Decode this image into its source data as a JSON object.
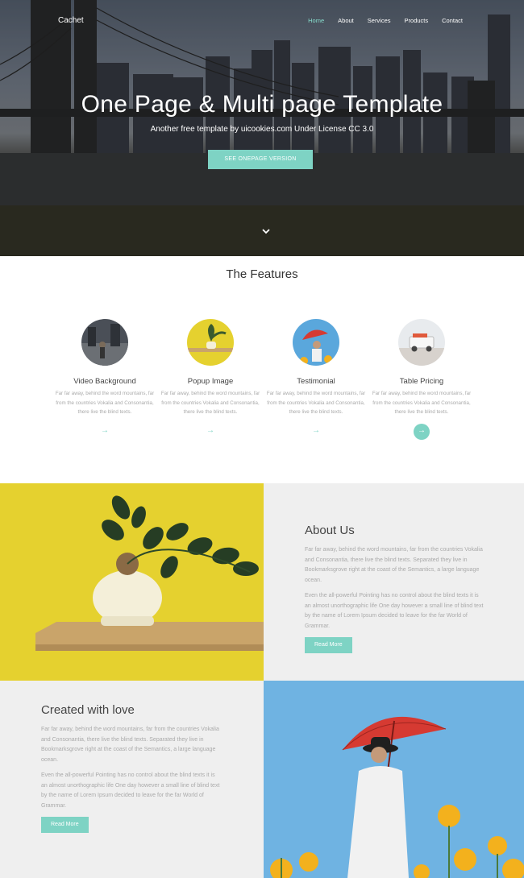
{
  "brand": "Cachet",
  "nav": [
    "Home",
    "About",
    "Services",
    "Products",
    "Contact"
  ],
  "hero": {
    "title": "One Page & Multi page Template",
    "subtitle": "Another free template by uicookies.com Under License CC 3.0",
    "cta": "SEE ONEPAGE VERSION"
  },
  "features": {
    "title": "The Features",
    "items": [
      {
        "title": "Video Background",
        "text": "Far far away, behind the word mountains, far from the countries Vokalia and Consonantia, there live the blind texts."
      },
      {
        "title": "Popup Image",
        "text": "Far far away, behind the word mountains, far from the countries Vokalia and Consonantia, there live the blind texts."
      },
      {
        "title": "Testimonial",
        "text": "Far far away, behind the word mountains, far from the countries Vokalia and Consonantia, there live the blind texts."
      },
      {
        "title": "Table Pricing",
        "text": "Far far away, behind the word mountains, far from the countries Vokalia and Consonantia, there live the blind texts."
      }
    ]
  },
  "about": {
    "title": "About Us",
    "p1": "Far far away, behind the word mountains, far from the countries Vokalia and Consonantia, there live the blind texts. Separated they live in Bookmarksgrove right at the coast of the Semantics, a large language ocean.",
    "p2": "Even the all-powerful Pointing has no control about the blind texts it is an almost unorthographic life One day however a small line of blind text by the name of Lorem Ipsum decided to leave for the far World of Grammar.",
    "button": "Read More"
  },
  "created": {
    "title": "Created with love",
    "p1": "Far far away, behind the word mountains, far from the countries Vokalia and Consonantia, there live the blind texts. Separated they live in Bookmarksgrove right at the coast of the Semantics, a large language ocean.",
    "p2": "Even the all-powerful Pointing has no control about the blind texts it is an almost unorthographic life One day however a small line of blind text by the name of Lorem Ipsum decided to leave for the far World of Grammar.",
    "button": "Read More"
  },
  "colors": {
    "accent": "#7ed3c4",
    "yellow": "#e5d12f",
    "panel": "#efefef"
  }
}
